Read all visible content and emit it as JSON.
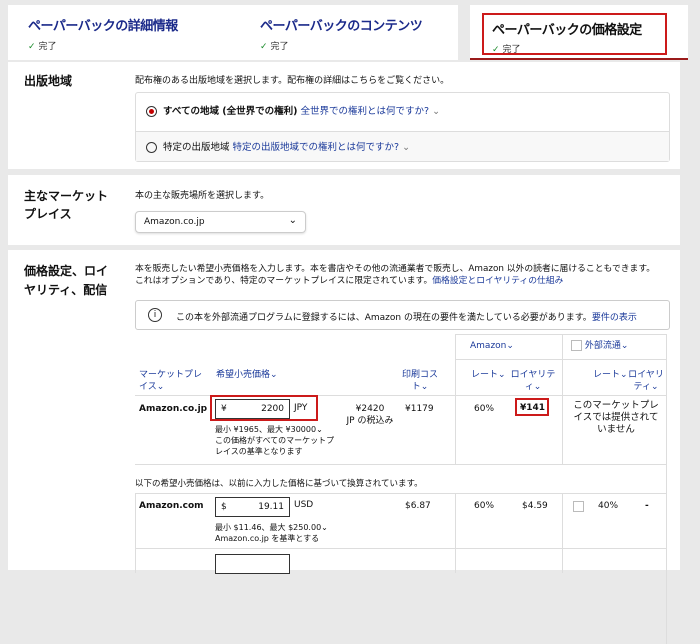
{
  "tabs": [
    {
      "title": "ペーパーバックの詳細情報",
      "status": "完了"
    },
    {
      "title": "ペーパーバックのコンテンツ",
      "status": "完了"
    },
    {
      "title": "ペーパーバックの価格設定",
      "status": "完了"
    }
  ],
  "territories": {
    "heading": "出版地域",
    "description": "配布権のある出版地域を選択します。配布権の詳細はこちらをご覧ください。",
    "option_all": "すべての地域 (全世界での権利)",
    "option_all_link": "全世界での権利とは何ですか?",
    "option_specific": "特定の出版地域",
    "option_specific_link": "特定の出版地域での権利とは何ですか?"
  },
  "marketplace": {
    "heading_line1": "主なマーケット",
    "heading_line2": "プレイス",
    "description": "本の主な販売場所を選択します。",
    "selected": "Amazon.co.jp"
  },
  "pricing": {
    "heading_line1": "価格設定、ロイ",
    "heading_line2": "ヤリティ、配信",
    "description_line1": "本を販売したい希望小売価格を入力します。本を書店やその他の流通業者で販売し、Amazon 以外の読者に届けることもできます。",
    "description_line2": "これはオプションであり、特定のマーケットプレイスに限定されています。",
    "description_link": "価格設定とロイヤリティの仕組み",
    "info_text": "この本を外部流通プログラムに登録するには、Amazon の現在の要件を満たしている必要があります。",
    "info_link": "要件の表示",
    "group_amazon": "Amazon⌄",
    "group_external": "外部流通⌄",
    "col_marketplace": "マーケットプレイス⌄",
    "col_price": "希望小売価格⌄",
    "col_print_cost": "印刷コスト⌄",
    "col_rate": "レート⌄",
    "col_royalty": "ロイヤリティ⌄",
    "col_ext_rate": "レート⌄",
    "col_ext_royalty": "ロイヤリティ⌄",
    "row_jp": {
      "marketplace": "Amazon.co.jp",
      "currency_symbol": "¥",
      "price": "2200",
      "currency": "JPY",
      "tax_line1": "¥2420",
      "tax_line2": "JP の税込み",
      "print_cost": "¥1179",
      "rate": "60%",
      "royalty": "¥141",
      "range": "最小 ¥1965、最大 ¥30000⌄",
      "note": "この価格がすべてのマーケットプレイスの基準となります",
      "external": "このマーケットプレイスでは提供されていません"
    },
    "converted_note": "以下の希望小売価格は、以前に入力した価格に基づいて換算されています。",
    "row_com": {
      "marketplace": "Amazon.com",
      "currency_symbol": "$",
      "price": "19.11",
      "currency": "USD",
      "print_cost": "$6.87",
      "rate": "60%",
      "royalty": "$4.59",
      "range": "最小 $11.46、最大 $250.00⌄",
      "note": "Amazon.co.jp を基準とする",
      "ext_rate": "40%",
      "ext_royalty": "-"
    }
  }
}
